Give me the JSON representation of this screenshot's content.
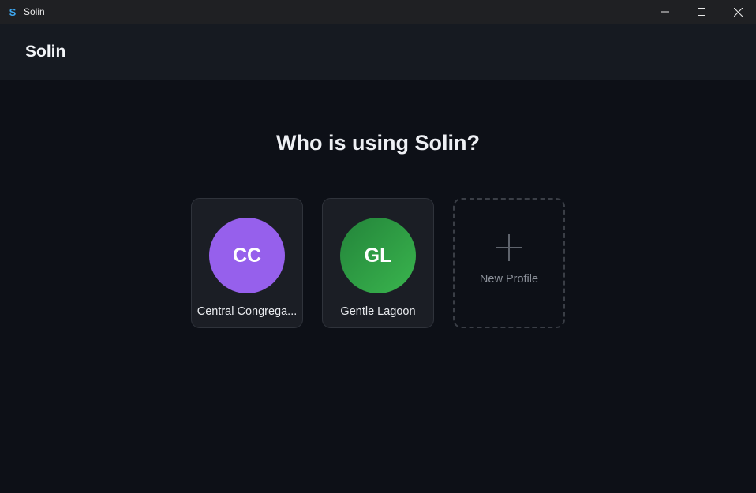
{
  "window": {
    "icon_letter": "S",
    "title": "Solin"
  },
  "header": {
    "brand": "Solin"
  },
  "main": {
    "heading": "Who is using Solin?",
    "profiles": [
      {
        "initials": "CC",
        "name": "Central Congrega...",
        "color": "#9660ec"
      },
      {
        "initials": "GL",
        "name": "Gentle Lagoon",
        "color": "#2f9e46"
      }
    ],
    "new_profile": {
      "label": "New Profile",
      "icon": "plus-icon"
    }
  },
  "colors": {
    "background": "#0d1017",
    "header": "#161a21",
    "titlebar": "#1f2023",
    "card": "#1b1e25",
    "accent": "#3ea7f0"
  }
}
